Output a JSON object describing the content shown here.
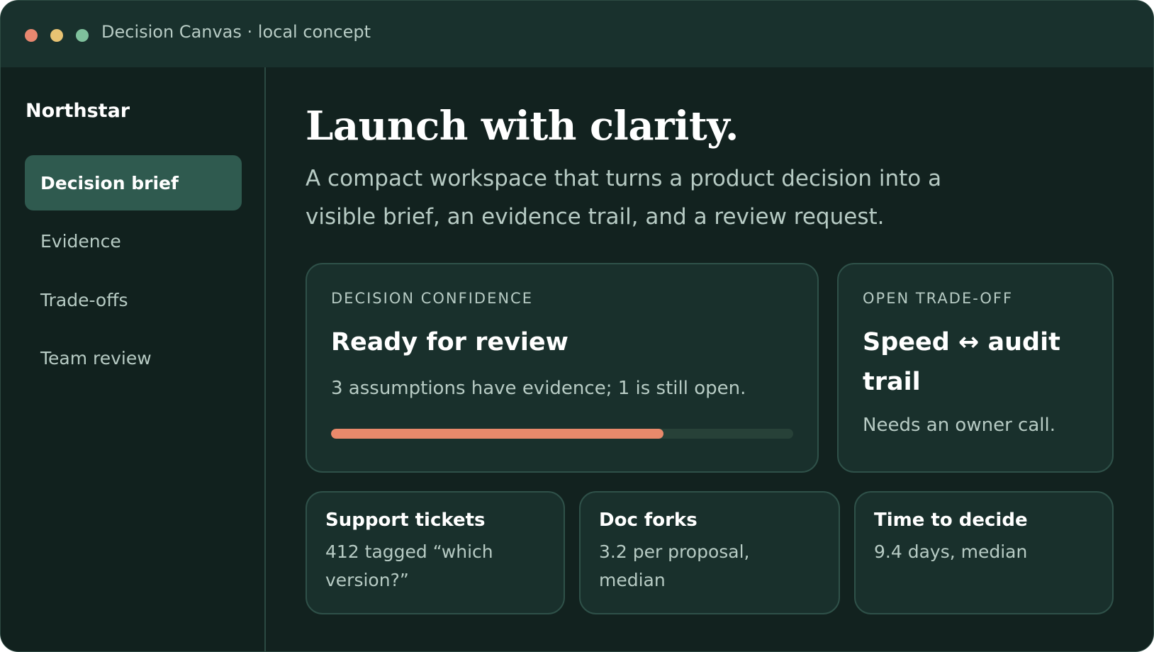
{
  "window": {
    "title": "Decision Canvas · local concept"
  },
  "sidebar": {
    "brand": "Northstar",
    "items": [
      {
        "label": "Decision brief",
        "active": true
      },
      {
        "label": "Evidence",
        "active": false
      },
      {
        "label": "Trade-offs",
        "active": false
      },
      {
        "label": "Team review",
        "active": false
      }
    ]
  },
  "main": {
    "headline": "Launch with clarity.",
    "subtitle": "A compact workspace that turns a product decision into a visible brief, an evidence trail, and a review request."
  },
  "confidence_card": {
    "eyebrow": "DECISION CONFIDENCE",
    "title": "Ready for review",
    "description": "3 assumptions have evidence; 1 is still open.",
    "progress_percent": 72
  },
  "tradeoff_card": {
    "eyebrow": "OPEN TRADE-OFF",
    "title": "Speed ↔ audit trail",
    "description": "Needs an owner call."
  },
  "metrics": [
    {
      "title": "Support tickets",
      "value": "412 tagged “which version?”"
    },
    {
      "title": "Doc forks",
      "value": "3.2 per proposal, median"
    },
    {
      "title": "Time to decide",
      "value": "9.4 days, median"
    }
  ],
  "colors": {
    "background": "#12221f",
    "titlebar": "#19312d",
    "accent": "#e9896b",
    "active_nav": "#2f5a4f",
    "dot_red": "#e8876f",
    "dot_yellow": "#e8c373",
    "dot_green": "#7fc19c"
  }
}
